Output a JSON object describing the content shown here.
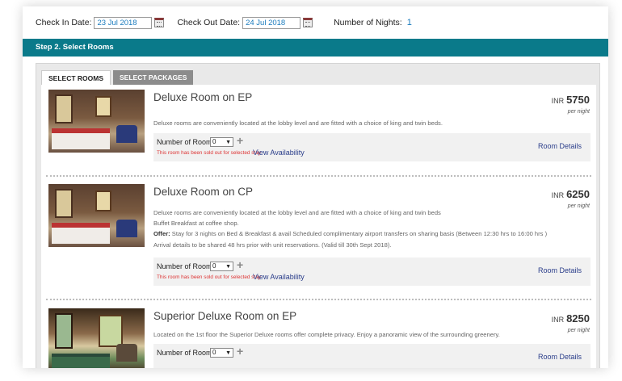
{
  "dates": {
    "check_in_label": "Check In Date:",
    "check_in_value": "23 Jul 2018",
    "check_out_label": "Check Out Date:",
    "check_out_value": "24 Jul 2018",
    "nights_label": "Number of Nights:",
    "nights_value": "1"
  },
  "step": {
    "title": "Step 2. Select Rooms"
  },
  "tabs": [
    {
      "label": "SELECT ROOMS",
      "active": true
    },
    {
      "label": "SELECT PACKAGES",
      "active": false
    }
  ],
  "rooms": [
    {
      "title": "Deluxe Room on EP",
      "currency": "INR",
      "price": "5750",
      "per": "per night",
      "desc": [
        "Deluxe rooms are conveniently located at the lobby level and are fitted with a choice of king and twin beds."
      ],
      "number_label": "Number of Room:",
      "qty": "0",
      "sold_out": "This room has been sold out for selected stay",
      "availability": "View Availability",
      "details": "Room Details"
    },
    {
      "title": "Deluxe Room on CP",
      "currency": "INR",
      "price": "6250",
      "per": "per night",
      "desc": [
        "Deluxe rooms are conveniently located at the lobby level and are fitted with a choice of king and twin beds",
        "Buffet Breakfast at coffee shop.",
        "Stay for 3 nights on Bed & Breakfast & avail Scheduled complimentary airport transfers on sharing basis (Between 12:30 hrs to 16:00 hrs )",
        "Arrival details to be shared 48 hrs prior with unit reservations. (Valid till 30th Sept 2018)."
      ],
      "offer_label": "Offer:",
      "number_label": "Number of Room:",
      "qty": "0",
      "sold_out": "This room has been sold out for selected stay",
      "availability": "View Availability",
      "details": "Room Details"
    },
    {
      "title": "Superior Deluxe Room on EP",
      "currency": "INR",
      "price": "8250",
      "per": "per night",
      "desc": [
        "Located on the 1st floor the Superior Deluxe rooms offer complete privacy. Enjoy a panoramic view of the surrounding greenery."
      ],
      "number_label": "Number of Room:",
      "qty": "0",
      "details": "Room Details"
    }
  ],
  "icons": {
    "calendar": "calendar-icon",
    "dropdown": "chevron-down-icon",
    "plus": "plus-icon"
  },
  "colors": {
    "accent": "#0a7a8a",
    "link": "#2a3d8a",
    "sold_out": "#dd3333",
    "date_text": "#1a7bbd"
  }
}
